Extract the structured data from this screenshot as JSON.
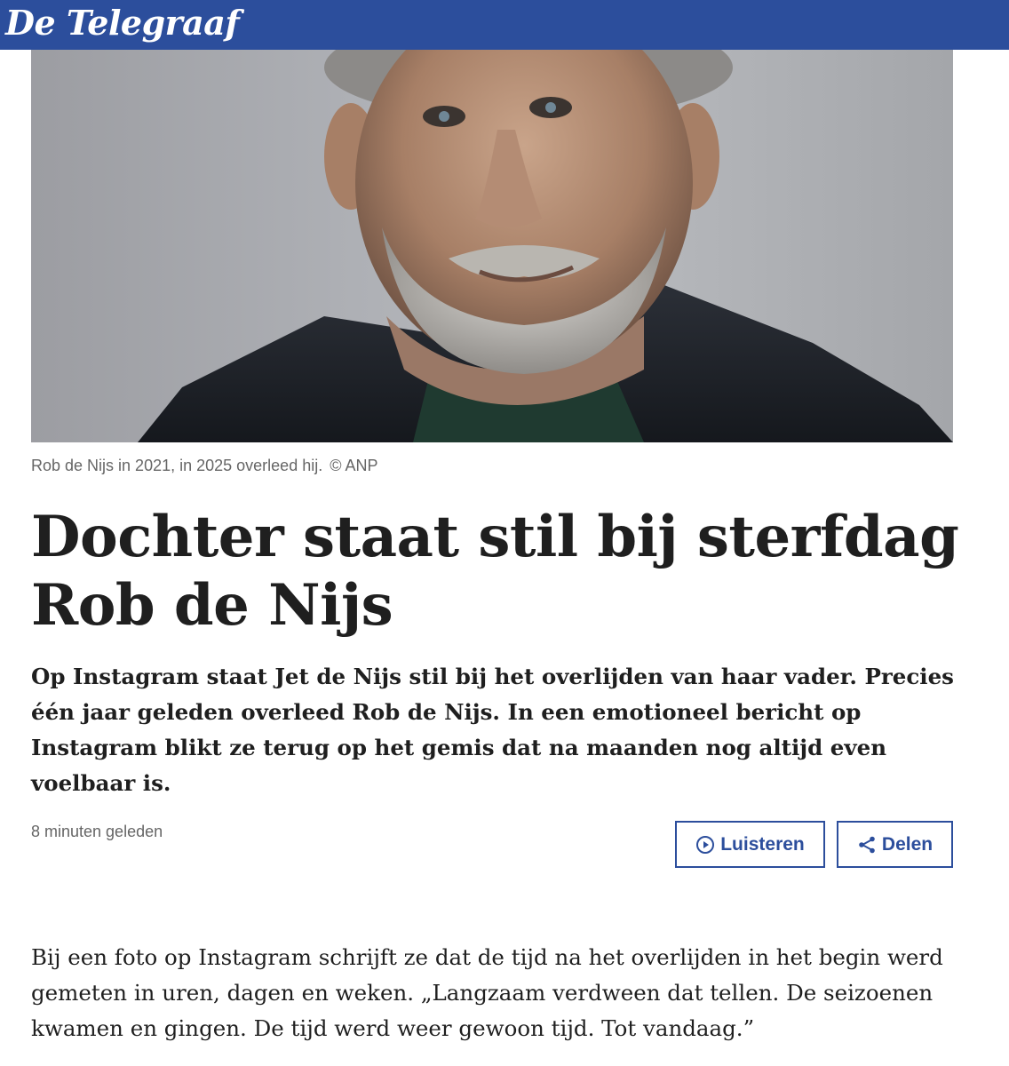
{
  "header": {
    "logo": "De Telegraaf",
    "brand_color": "#2c4e9c"
  },
  "hero": {
    "image_description_icon": "portrait-photo",
    "caption": "Rob de Nijs in 2021, in 2025 overleed hij.",
    "credit": "© ANP"
  },
  "article": {
    "headline": "Dochter staat stil bij sterfdag Rob de Nijs",
    "lead": "Op Instagram staat Jet de Nijs stil bij het overlijden van haar vader. Precies één jaar geleden overleed Rob de Nijs. In een emotioneel bericht op Instagram blikt ze terug op het gemis dat na maanden nog altijd even voelbaar is.",
    "timestamp": "8 minuten geleden",
    "body": "Bij een foto op Instagram schrijft ze dat de tijd na het overlijden in het begin werd gemeten in uren, dagen en weken. „Langzaam verdween dat tellen. De seizoenen kwamen en gingen. De tijd werd weer gewoon tijd. Tot vandaag.”"
  },
  "actions": {
    "listen_label": "Luisteren",
    "listen_icon": "play-circle-icon",
    "share_label": "Delen",
    "share_icon": "share-icon"
  }
}
